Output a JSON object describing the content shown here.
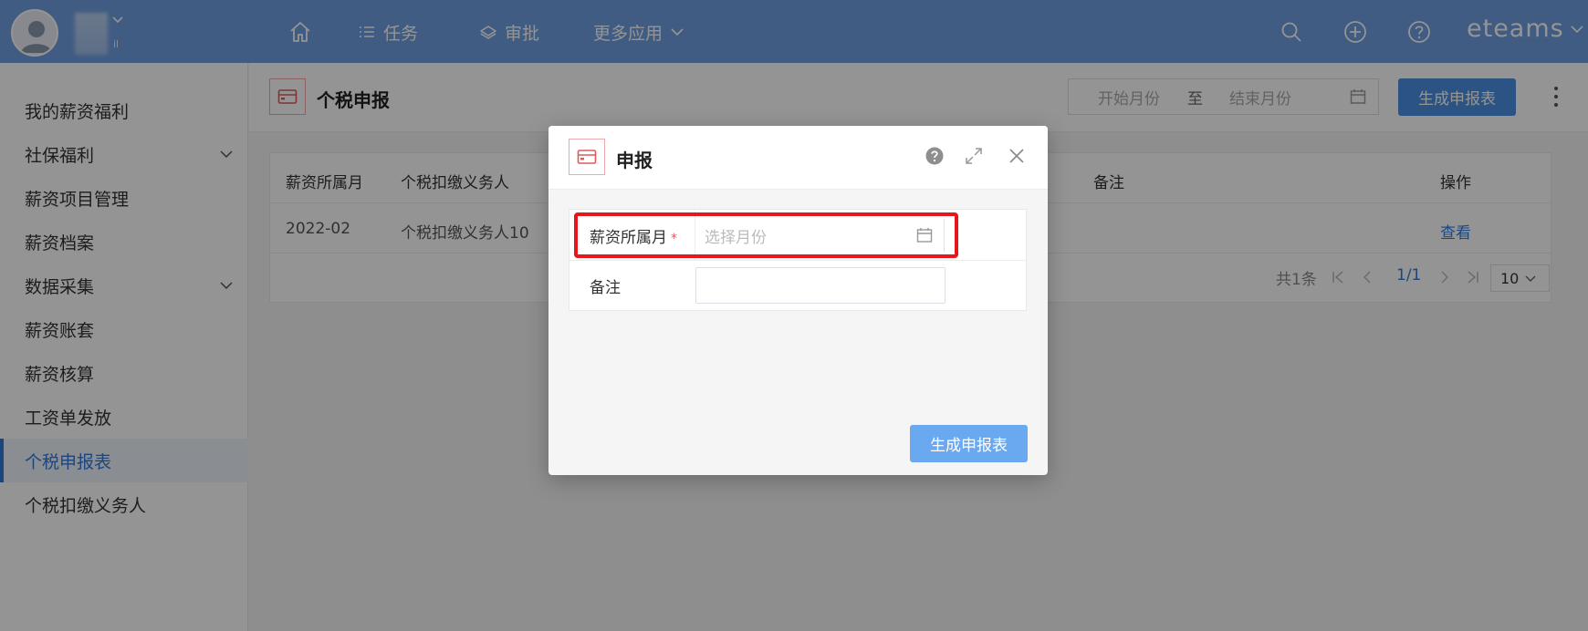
{
  "topbar": {
    "nav": [
      {
        "label": "",
        "icon": "home-icon"
      },
      {
        "label": "任务",
        "icon": "list-icon"
      },
      {
        "label": "审批",
        "icon": "layers-icon"
      },
      {
        "label": "更多应用",
        "icon": "chevron-down-icon"
      }
    ],
    "user_mini": "il",
    "brand": "eteams",
    "colors": {
      "bar": "#6f9fe0",
      "accent": "#2f7ad9",
      "danger": "#e8161b"
    }
  },
  "sidebar": {
    "items": [
      {
        "label": "我的薪资福利",
        "expandable": false
      },
      {
        "label": "社保福利",
        "expandable": true
      },
      {
        "label": "薪资项目管理",
        "expandable": false
      },
      {
        "label": "薪资档案",
        "expandable": false
      },
      {
        "label": "数据采集",
        "expandable": true
      },
      {
        "label": "薪资账套",
        "expandable": false
      },
      {
        "label": "薪资核算",
        "expandable": false
      },
      {
        "label": "工资单发放",
        "expandable": false
      },
      {
        "label": "个税申报表",
        "expandable": false,
        "active": true
      },
      {
        "label": "个税扣缴义务人",
        "expandable": false
      }
    ]
  },
  "header": {
    "title": "个税申报",
    "start_placeholder": "开始月份",
    "range_sep": "至",
    "end_placeholder": "结束月份",
    "generate_label": "生成申报表"
  },
  "table": {
    "columns": [
      "薪资所属月",
      "个税扣缴义务人",
      "备注",
      "操作"
    ],
    "rows": [
      {
        "month": "2022-02",
        "agent": "个税扣缴义务人10",
        "remark": "",
        "action": "查看"
      }
    ],
    "pager": {
      "total": "共1条",
      "page": "1/1",
      "size": "10"
    }
  },
  "modal": {
    "title": "申报",
    "month_label": "薪资所属月",
    "required_mark": "*",
    "month_placeholder": "选择月份",
    "remark_label": "备注",
    "remark_value": "",
    "submit_label": "生成申报表"
  }
}
